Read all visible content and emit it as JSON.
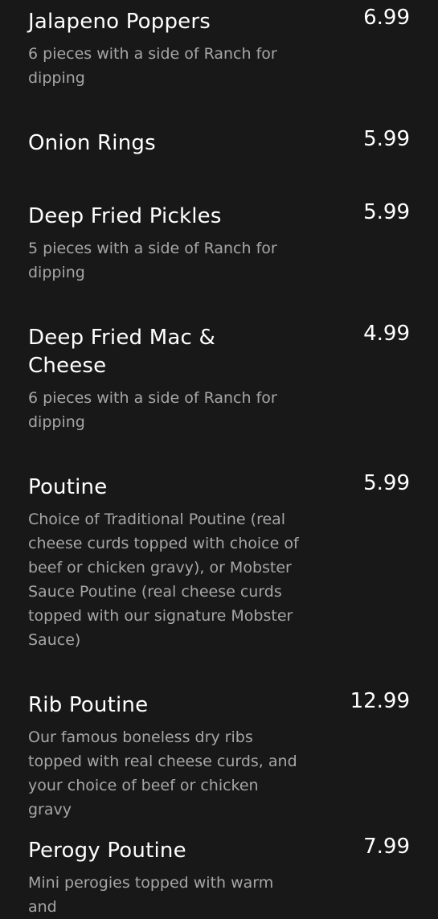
{
  "menu": {
    "items": [
      {
        "name": "Jalapeno Poppers",
        "price": "6.99",
        "description": "6 pieces with a side of Ranch for dipping"
      },
      {
        "name": "Onion Rings",
        "price": "5.99",
        "description": ""
      },
      {
        "name": "Deep Fried Pickles",
        "price": "5.99",
        "description": "5 pieces with a side of Ranch for dipping"
      },
      {
        "name": "Deep Fried Mac & Cheese",
        "price": "4.99",
        "description": "6 pieces with a side of Ranch for dipping"
      },
      {
        "name": "Poutine",
        "price": "5.99",
        "description": "Choice of Traditional Poutine (real cheese curds topped with choice of beef or chicken gravy), or Mobster Sauce Poutine (real cheese curds topped with our signature Mobster Sauce)"
      },
      {
        "name": "Rib Poutine",
        "price": "12.99",
        "description": "Our famous boneless dry ribs topped with real cheese curds, and your choice of beef or chicken gravy"
      },
      {
        "name": "Perogy Poutine",
        "price": "7.99",
        "description": "Mini perogies topped with warm and"
      }
    ]
  }
}
